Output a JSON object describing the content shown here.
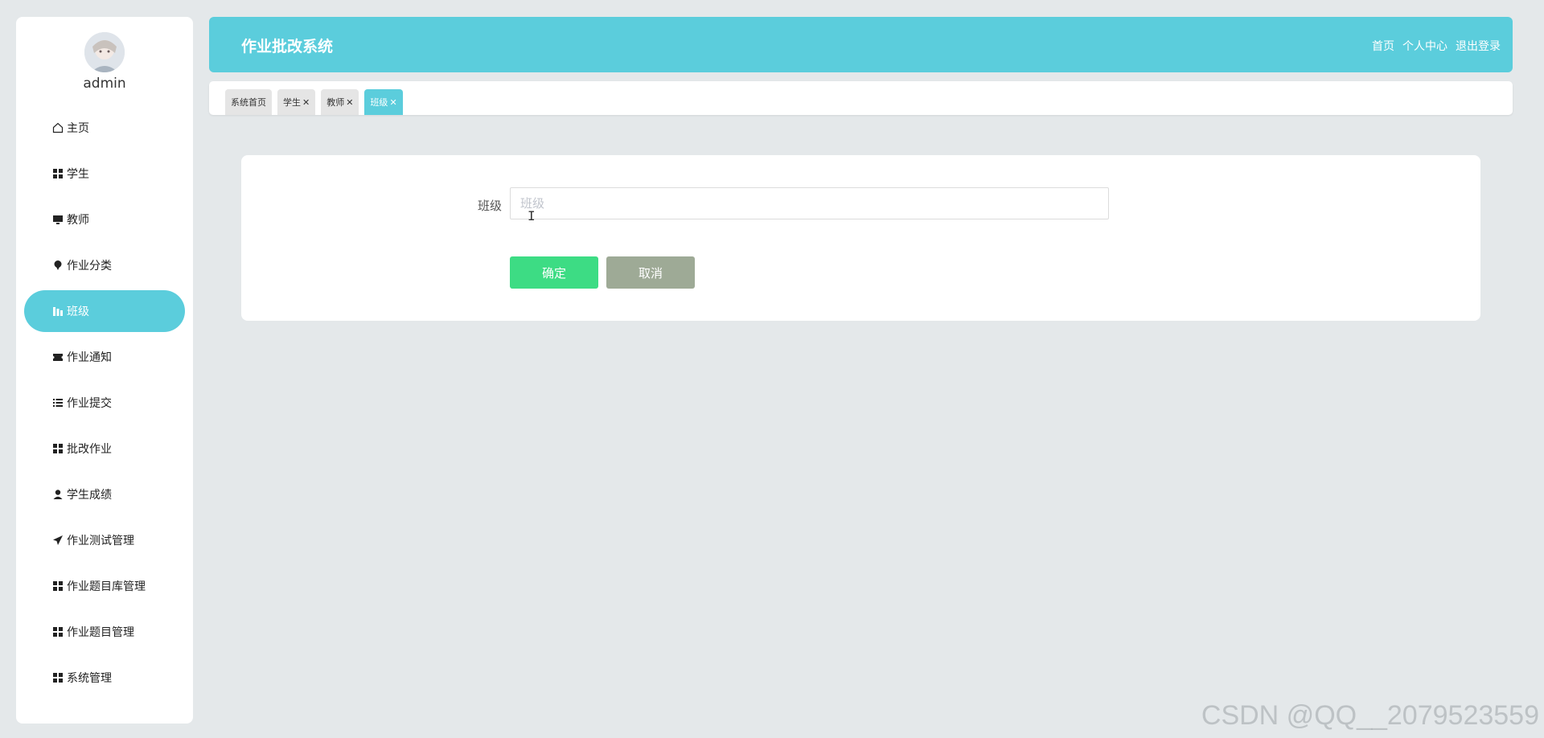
{
  "app": {
    "title": "作业批改系统",
    "header_links": [
      "首页",
      "个人中心",
      "退出登录"
    ]
  },
  "user": {
    "name": "admin"
  },
  "sidebar": {
    "items": [
      {
        "label": "主页",
        "icon": "home-icon",
        "active": false
      },
      {
        "label": "学生",
        "icon": "grid-icon",
        "active": false
      },
      {
        "label": "教师",
        "icon": "monitor-icon",
        "active": false
      },
      {
        "label": "作业分类",
        "icon": "pin-icon",
        "active": false
      },
      {
        "label": "班级",
        "icon": "bar-chart-icon",
        "active": true
      },
      {
        "label": "作业通知",
        "icon": "ticket-icon",
        "active": false
      },
      {
        "label": "作业提交",
        "icon": "list-icon",
        "active": false
      },
      {
        "label": "批改作业",
        "icon": "grid-icon",
        "active": false
      },
      {
        "label": "学生成绩",
        "icon": "user-icon",
        "active": false
      },
      {
        "label": "作业测试管理",
        "icon": "send-icon",
        "active": false
      },
      {
        "label": "作业题目库管理",
        "icon": "grid-icon",
        "active": false
      },
      {
        "label": "作业题目管理",
        "icon": "grid-icon",
        "active": false
      },
      {
        "label": "系统管理",
        "icon": "grid-icon",
        "active": false
      }
    ]
  },
  "tabs": [
    {
      "label": "系统首页",
      "closable": false,
      "active": false
    },
    {
      "label": "学生",
      "closable": true,
      "active": false
    },
    {
      "label": "教师",
      "closable": true,
      "active": false
    },
    {
      "label": "班级",
      "closable": true,
      "active": true
    }
  ],
  "form": {
    "field_label": "班级",
    "field_value": "",
    "field_placeholder": "班级",
    "confirm_label": "确定",
    "cancel_label": "取消"
  },
  "watermark": "CSDN @QQ__2079523559",
  "colors": {
    "accent": "#5bcddc",
    "confirm": "#3ddc84",
    "cancel": "#9eaa96",
    "background": "#e4e8ea"
  }
}
